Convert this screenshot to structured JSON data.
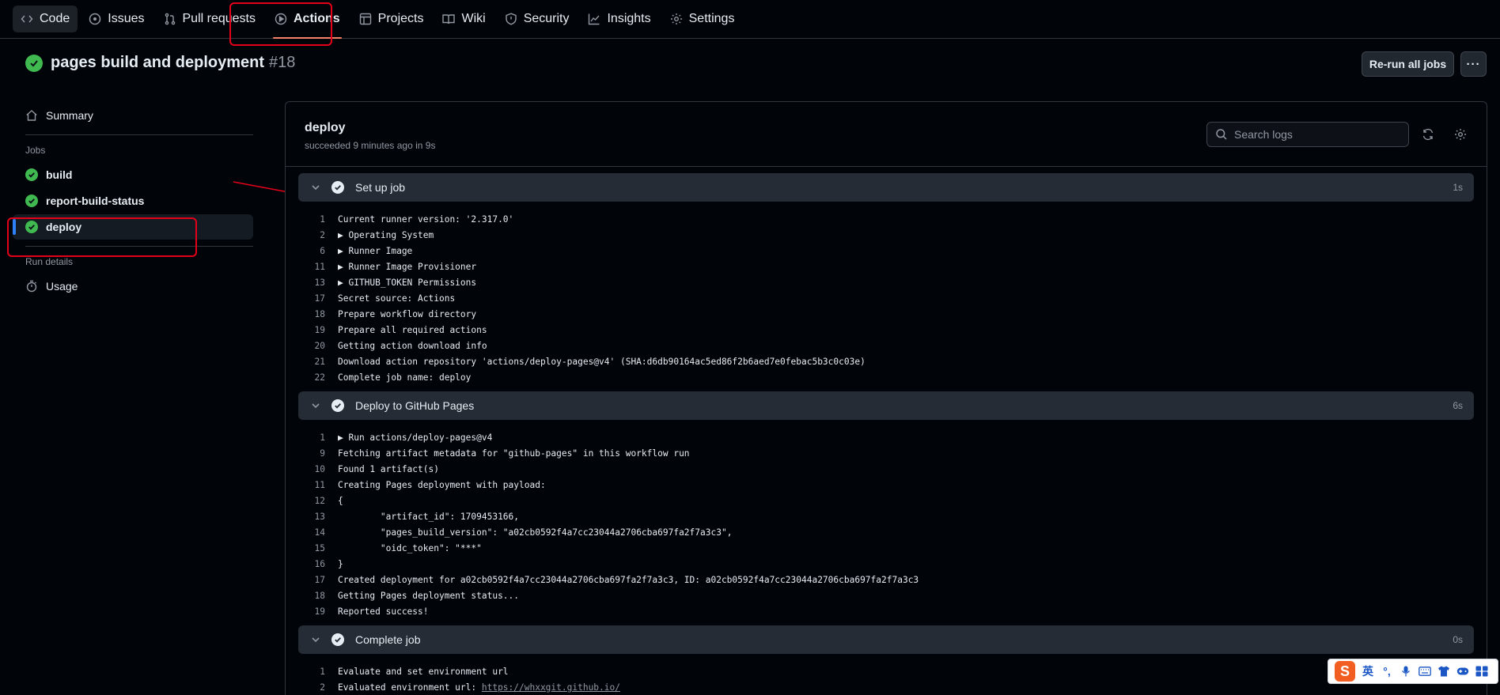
{
  "nav": {
    "tabs": [
      {
        "label": "Code",
        "icon": "code-icon"
      },
      {
        "label": "Issues",
        "icon": "issue-icon"
      },
      {
        "label": "Pull requests",
        "icon": "pull-request-icon"
      },
      {
        "label": "Actions",
        "icon": "play-icon",
        "active": true
      },
      {
        "label": "Projects",
        "icon": "table-icon"
      },
      {
        "label": "Wiki",
        "icon": "book-icon"
      },
      {
        "label": "Security",
        "icon": "shield-icon"
      },
      {
        "label": "Insights",
        "icon": "graph-icon"
      },
      {
        "label": "Settings",
        "icon": "gear-icon"
      }
    ]
  },
  "run": {
    "title": "pages build and deployment",
    "number": "#18",
    "rerun_label": "Re-run all jobs",
    "more_label": "···"
  },
  "sidebar": {
    "summary": "Summary",
    "jobs_heading": "Jobs",
    "jobs": [
      "build",
      "report-build-status",
      "deploy"
    ],
    "run_details_heading": "Run details",
    "usage": "Usage"
  },
  "job": {
    "title": "deploy",
    "subtitle": "succeeded 9 minutes ago in 9s",
    "search_placeholder": "Search logs"
  },
  "steps": [
    {
      "name": "Set up job",
      "duration": "1s",
      "lines": [
        {
          "n": "1",
          "t": "Current runner version: '2.317.0'"
        },
        {
          "n": "2",
          "t": "▶ Operating System"
        },
        {
          "n": "6",
          "t": "▶ Runner Image"
        },
        {
          "n": "11",
          "t": "▶ Runner Image Provisioner"
        },
        {
          "n": "13",
          "t": "▶ GITHUB_TOKEN Permissions"
        },
        {
          "n": "17",
          "t": "Secret source: Actions"
        },
        {
          "n": "18",
          "t": "Prepare workflow directory"
        },
        {
          "n": "19",
          "t": "Prepare all required actions"
        },
        {
          "n": "20",
          "t": "Getting action download info"
        },
        {
          "n": "21",
          "t": "Download action repository 'actions/deploy-pages@v4' (SHA:d6db90164ac5ed86f2b6aed7e0febac5b3c0c03e)"
        },
        {
          "n": "22",
          "t": "Complete job name: deploy"
        }
      ]
    },
    {
      "name": "Deploy to GitHub Pages",
      "duration": "6s",
      "lines": [
        {
          "n": "1",
          "t": "▶ Run actions/deploy-pages@v4"
        },
        {
          "n": "9",
          "t": "Fetching artifact metadata for \"github-pages\" in this workflow run"
        },
        {
          "n": "10",
          "t": "Found 1 artifact(s)"
        },
        {
          "n": "11",
          "t": "Creating Pages deployment with payload:"
        },
        {
          "n": "12",
          "t": "{"
        },
        {
          "n": "13",
          "t": "\t\"artifact_id\": 1709453166,"
        },
        {
          "n": "14",
          "t": "\t\"pages_build_version\": \"a02cb0592f4a7cc23044a2706cba697fa2f7a3c3\","
        },
        {
          "n": "15",
          "t": "\t\"oidc_token\": \"***\""
        },
        {
          "n": "16",
          "t": "}"
        },
        {
          "n": "17",
          "t": "Created deployment for a02cb0592f4a7cc23044a2706cba697fa2f7a3c3, ID: a02cb0592f4a7cc23044a2706cba697fa2f7a3c3"
        },
        {
          "n": "18",
          "t": "Getting Pages deployment status..."
        },
        {
          "n": "19",
          "t": "Reported success!"
        }
      ]
    },
    {
      "name": "Complete job",
      "duration": "0s",
      "lines": [
        {
          "n": "1",
          "t": "Evaluate and set environment url"
        },
        {
          "n": "2",
          "t": "Evaluated environment url: ",
          "url": "https://whxxgit.github.io/"
        }
      ]
    }
  ],
  "ime": {
    "logo": "S",
    "lang": "英"
  },
  "colors": {
    "success": "#3fb950",
    "annotation": "#e5001a",
    "accent": "#f78166",
    "selected": "#2f81f7"
  }
}
